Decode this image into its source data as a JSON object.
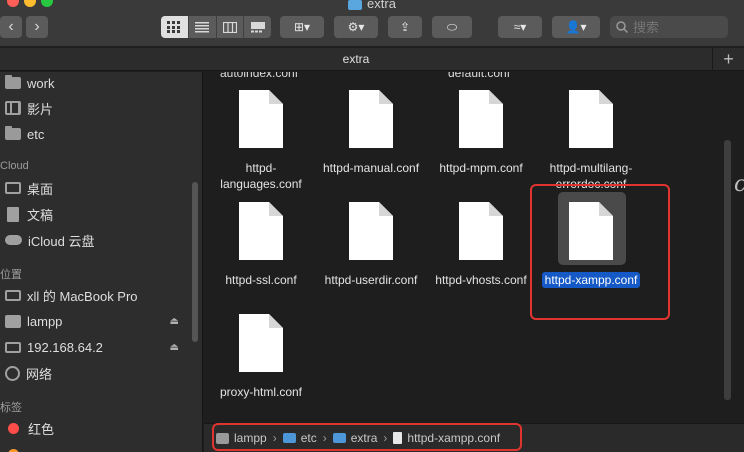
{
  "window": {
    "title": "extra",
    "tab_label": "extra",
    "tab_add": "+",
    "back_glyph": "‹",
    "forward_glyph": "›"
  },
  "toolbar": {
    "group_glyph": "⊞▾",
    "action_glyph": "⚙▾",
    "share_glyph": "⇪",
    "tag_glyph": "⬭",
    "edit_glyph": "≈▾",
    "user_glyph": "👤▾",
    "search_placeholder": "搜索"
  },
  "sidebar": {
    "favorites": [
      {
        "label": "work",
        "icon": "folder-icon"
      },
      {
        "label": "影片",
        "icon": "film-icon"
      },
      {
        "label": "etc",
        "icon": "folder-icon"
      }
    ],
    "icloud_header": "Cloud",
    "icloud": [
      {
        "label": "桌面",
        "icon": "desktop-icon"
      },
      {
        "label": "文稿",
        "icon": "document-icon"
      },
      {
        "label": "iCloud 云盘",
        "icon": "cloud-icon"
      }
    ],
    "locations_header": "位置",
    "locations": [
      {
        "label": "xll 的 MacBook Pro",
        "icon": "laptop-icon"
      },
      {
        "label": "lampp",
        "icon": "disk-icon",
        "eject": "⏏"
      },
      {
        "label": "192.168.64.2",
        "icon": "monitor-icon",
        "eject": "⏏"
      },
      {
        "label": "网络",
        "icon": "globe-icon"
      }
    ],
    "tags_header": "标签",
    "tags": [
      {
        "label": "红色",
        "color": "#ff4d4a"
      }
    ]
  },
  "content": {
    "cut_labels": [
      "autoindex.conf",
      "default.conf"
    ],
    "files": [
      {
        "label": "httpd-languages.conf",
        "selected": false
      },
      {
        "label": "httpd-manual.conf",
        "selected": false
      },
      {
        "label": "httpd-mpm.conf",
        "selected": false
      },
      {
        "label": "httpd-multilang-errordoc.conf",
        "selected": false
      },
      {
        "label": "httpd-ssl.conf",
        "selected": false
      },
      {
        "label": "httpd-userdir.conf",
        "selected": false
      },
      {
        "label": "httpd-vhosts.conf",
        "selected": false
      },
      {
        "label": "httpd-xampp.conf",
        "selected": true
      },
      {
        "label": "proxy-html.conf",
        "selected": false
      }
    ]
  },
  "pathbar": {
    "items": [
      "lampp",
      "etc",
      "extra",
      "httpd-xampp.conf"
    ],
    "separator": "›"
  },
  "colors": {
    "highlight": "#e0352f",
    "selection": "#1459c6"
  }
}
